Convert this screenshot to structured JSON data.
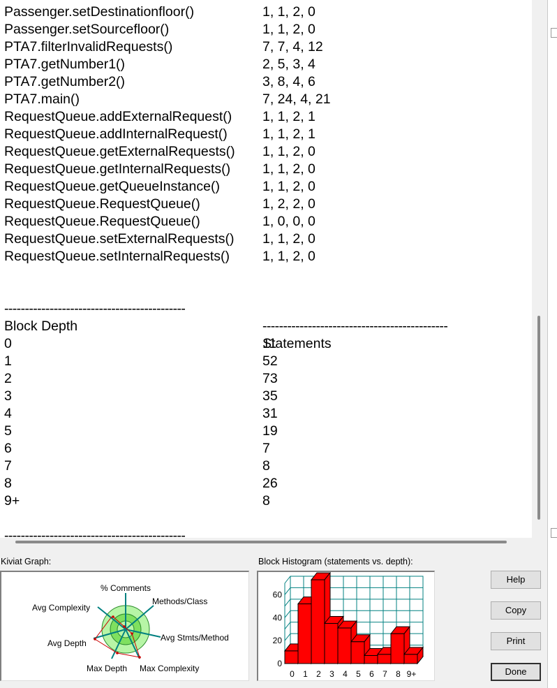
{
  "methods": [
    {
      "name": "Passenger.setDestinationfloor()",
      "values": "1, 1, 2, 0"
    },
    {
      "name": "Passenger.setSourcefloor()",
      "values": "1, 1, 2, 0"
    },
    {
      "name": "PTA7.filterInvalidRequests()",
      "values": "7, 7, 4, 12"
    },
    {
      "name": "PTA7.getNumber1()",
      "values": "2, 5, 3, 4"
    },
    {
      "name": "PTA7.getNumber2()",
      "values": "3, 8, 4, 6"
    },
    {
      "name": "PTA7.main()",
      "values": "7, 24, 4, 21"
    },
    {
      "name": "RequestQueue.addExternalRequest()",
      "values": "1, 1, 2, 1"
    },
    {
      "name": "RequestQueue.addInternalRequest()",
      "values": "1, 1, 2, 1"
    },
    {
      "name": "RequestQueue.getExternalRequests()",
      "values": "1, 1, 2, 0"
    },
    {
      "name": "RequestQueue.getInternalRequests()",
      "values": "1, 1, 2, 0"
    },
    {
      "name": "RequestQueue.getQueueInstance()",
      "values": "1, 1, 2, 0"
    },
    {
      "name": "RequestQueue.RequestQueue()",
      "values": "1, 2, 2, 0"
    },
    {
      "name": "RequestQueue.RequestQueue()",
      "values": "1, 0, 0, 0"
    },
    {
      "name": "RequestQueue.setExternalRequests()",
      "values": "1, 1, 2, 0"
    },
    {
      "name": "RequestQueue.setInternalRequests()",
      "values": "1, 1, 2, 0"
    }
  ],
  "separator_left": "--------------------------------------------",
  "separator_right": "---------------------------------------------",
  "block_header": {
    "depth": "Block Depth",
    "statements": "Statements"
  },
  "blocks": [
    {
      "depth": "0",
      "statements": "11"
    },
    {
      "depth": "1",
      "statements": "52"
    },
    {
      "depth": "2",
      "statements": "73"
    },
    {
      "depth": "3",
      "statements": "35"
    },
    {
      "depth": "4",
      "statements": "31"
    },
    {
      "depth": "5",
      "statements": "19"
    },
    {
      "depth": "6",
      "statements": "7"
    },
    {
      "depth": "7",
      "statements": "8"
    },
    {
      "depth": "8",
      "statements": "26"
    },
    {
      "depth": "9+",
      "statements": "8"
    }
  ],
  "kiviat": {
    "label": "Kiviat Graph:",
    "axes": [
      "% Comments",
      "Methods/Class",
      "Avg Stmts/Method",
      "Max Complexity",
      "Max Depth",
      "Avg Depth",
      "Avg Complexity"
    ]
  },
  "histogram": {
    "label": "Block Histogram (statements vs. depth):",
    "y_ticks": [
      "0",
      "20",
      "40",
      "60"
    ]
  },
  "buttons": {
    "help": "Help",
    "copy": "Copy",
    "print": "Print",
    "done": "Done"
  },
  "colors": {
    "bar_fill": "#ff0000",
    "bar_edge": "#000000",
    "grid": "#008080",
    "kiviat_outer": "#b7f5a6",
    "kiviat_inner": "#7fe05f",
    "kiviat_line": "#cc0000"
  },
  "chart_data": {
    "type": "bar",
    "categories": [
      "0",
      "1",
      "2",
      "3",
      "4",
      "5",
      "6",
      "7",
      "8",
      "9+"
    ],
    "values": [
      11,
      52,
      73,
      35,
      31,
      19,
      7,
      8,
      26,
      8
    ],
    "title": "Block Histogram (statements vs. depth):",
    "xlabel": "",
    "ylabel": "",
    "ylim": [
      0,
      70
    ],
    "grid": true
  }
}
